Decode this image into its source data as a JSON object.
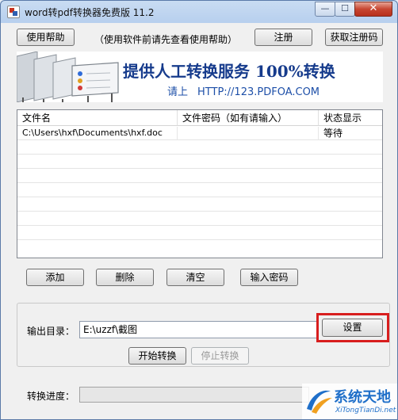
{
  "window": {
    "title": "word转pdf转换器免费版 11.2",
    "controls": {
      "minimize": "—",
      "maximize": "☐",
      "close": "✕"
    }
  },
  "toolbar": {
    "help_button": "使用帮助",
    "help_note": "（使用软件前请先查看使用帮助）",
    "register_button": "注册",
    "get_code_button": "获取注册码"
  },
  "banner": {
    "headline": "提供人工转换服务 100%转换",
    "sub_prefix": "请上",
    "sub_url": "HTTP://123.PDFOA.COM"
  },
  "file_table": {
    "columns": [
      "文件名",
      "文件密码（如有请输入）",
      "状态显示"
    ],
    "rows": [
      {
        "file": "C:\\Users\\hxf\\Documents\\hxf.doc",
        "password": "",
        "status": "等待"
      }
    ]
  },
  "list_actions": {
    "add": "添加",
    "delete": "删除",
    "clear": "清空",
    "enter_password": "输入密码"
  },
  "output": {
    "label": "输出目录：",
    "directory": "E:\\uzzf\\截图",
    "settings_button": "设置",
    "start_button": "开始转换",
    "stop_button": "停止转换"
  },
  "progress": {
    "label": "转换进度：",
    "value": 0
  },
  "watermark": {
    "title": "系统天地",
    "url": "XiTongTianDi.net"
  },
  "colors": {
    "accent_blue": "#163b8c",
    "highlight_red": "#d81e1e",
    "watermark_blue": "#1f6fc9"
  }
}
